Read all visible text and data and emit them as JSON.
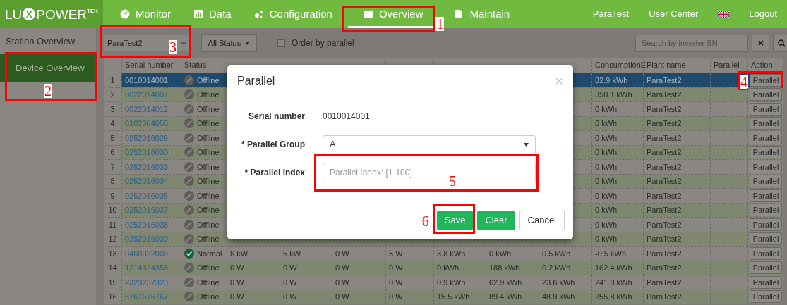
{
  "nav": {
    "logo": {
      "left": "LU",
      "mark": "X",
      "right": "POWER",
      "suffix": "TEK"
    },
    "tabs": [
      {
        "label": "Monitor",
        "selected": false
      },
      {
        "label": "Data",
        "selected": false
      },
      {
        "label": "Configuration",
        "selected": false
      },
      {
        "label": "Overview",
        "selected": true,
        "annotation": "1"
      },
      {
        "label": "Maintain",
        "selected": false
      }
    ],
    "right": [
      "ParaTest",
      "User Center"
    ],
    "logout": "Logout"
  },
  "sidebar": {
    "items": [
      {
        "label": "Station Overview",
        "selected": false
      },
      {
        "label": "Device Overview",
        "selected": true,
        "annotation": "2"
      }
    ]
  },
  "toolbar": {
    "plant_select": {
      "value": "ParaTest2",
      "annotation": "3"
    },
    "status_select": {
      "value": "All Status"
    },
    "order_checkbox": {
      "label": "Order by parallel",
      "checked": false
    },
    "search": {
      "placeholder": "Search by inverter SN"
    }
  },
  "table": {
    "columns": [
      "Serial number",
      "Status",
      "ConsumptionE",
      "Plant name",
      "Parallel",
      "Action"
    ],
    "rows": [
      {
        "index": "1",
        "serial": "0010014001",
        "status": {
          "kind": "offline",
          "label": "Offline"
        },
        "consumption": "82.9 kWh",
        "plant": "ParaTest2",
        "action": "Parallel",
        "annotation": "4",
        "selected": true
      },
      {
        "index": "2",
        "serial": "0022014007",
        "status": {
          "kind": "offline",
          "label": "Offline"
        },
        "consumption": "350.1 kWh",
        "plant": "ParaTest2",
        "action": "Parallel",
        "selected": false
      },
      {
        "index": "3",
        "serial": "0022014012",
        "status": {
          "kind": "offline",
          "label": "Offline"
        },
        "consumption": "0 kWh",
        "plant": "ParaTest2",
        "action": "Parallel",
        "selected": false
      },
      {
        "index": "4",
        "serial": "0102004050",
        "status": {
          "kind": "offline",
          "label": "Offline"
        },
        "consumption": "0 kWh",
        "plant": "ParaTest2",
        "action": "Parallel",
        "selected": false
      },
      {
        "index": "5",
        "serial": "0252016029",
        "status": {
          "kind": "offline",
          "label": "Offline"
        },
        "consumption": "0 kWh",
        "plant": "ParaTest2",
        "action": "Parallel",
        "selected": false
      },
      {
        "index": "6",
        "serial": "0252016030",
        "status": {
          "kind": "offline",
          "label": "Offline"
        },
        "consumption": "0 kWh",
        "plant": "ParaTest2",
        "action": "Parallel",
        "selected": false
      },
      {
        "index": "7",
        "serial": "0252016033",
        "status": {
          "kind": "offline",
          "label": "Offline"
        },
        "consumption": "0 kWh",
        "plant": "ParaTest2",
        "action": "Parallel",
        "selected": false
      },
      {
        "index": "8",
        "serial": "0252016034",
        "status": {
          "kind": "offline",
          "label": "Offline"
        },
        "consumption": "0 kWh",
        "plant": "ParaTest2",
        "action": "Parallel",
        "selected": false
      },
      {
        "index": "9",
        "serial": "0252016035",
        "status": {
          "kind": "offline",
          "label": "Offline"
        },
        "consumption": "0 kWh",
        "plant": "ParaTest2",
        "action": "Parallel",
        "selected": false
      },
      {
        "index": "10",
        "serial": "0252016037",
        "status": {
          "kind": "offline",
          "label": "Offline"
        },
        "consumption": "0 kWh",
        "plant": "ParaTest2",
        "action": "Parallel",
        "selected": false
      },
      {
        "index": "11",
        "serial": "0252016038",
        "status": {
          "kind": "offline",
          "label": "Offline"
        },
        "consumption": "0 kWh",
        "plant": "ParaTest2",
        "action": "Parallel",
        "selected": false
      },
      {
        "index": "12",
        "serial": "0252016039",
        "status": {
          "kind": "offline",
          "label": "Offline"
        },
        "consumption": "0 kWh",
        "plant": "ParaTest2",
        "action": "Parallel",
        "selected": false
      },
      {
        "index": "13",
        "serial": "0460022009",
        "status": {
          "kind": "normal",
          "label": "Normal"
        },
        "values": [
          "6 kW",
          "5 kW",
          "0 W",
          "5 W",
          "3.8 kWh",
          "0 kWh",
          "0.5 kWh"
        ],
        "consumption": "-0.5 kWh",
        "plant": "ParaTest2",
        "action": "Parallel",
        "selected": false
      },
      {
        "index": "14",
        "serial": "1214324353",
        "status": {
          "kind": "offline",
          "label": "Offline"
        },
        "values": [
          "0 W",
          "0 W",
          "0 W",
          "0 W",
          "0 kWh",
          "188 kWh",
          "0.2 kWh"
        ],
        "consumption": "162.4 kWh",
        "plant": "ParaTest2",
        "action": "Parallel",
        "selected": false
      },
      {
        "index": "15",
        "serial": "2323232323",
        "status": {
          "kind": "offline",
          "label": "Offline"
        },
        "values": [
          "0 W",
          "0 W",
          "0 W",
          "0 W",
          "0.9 kWh",
          "62.9 kWh",
          "23.6 kWh"
        ],
        "consumption": "241.8 kWh",
        "plant": "ParaTest2",
        "action": "Parallel",
        "selected": false
      },
      {
        "index": "16",
        "serial": "6767676767",
        "status": {
          "kind": "offline",
          "label": "Offline"
        },
        "values": [
          "0 W",
          "0 W",
          "0 W",
          "0 W",
          "15.5 kWh",
          "89.4 kWh",
          "48.9 kWh"
        ],
        "consumption": "255.8 kWh",
        "plant": "ParaTest2",
        "action": "Parallel",
        "selected": false
      }
    ]
  },
  "modal": {
    "title": "Parallel",
    "close": "×",
    "serial": {
      "label": "Serial number",
      "value": "0010014001"
    },
    "group": {
      "label": "* Parallel Group",
      "value": "A"
    },
    "index": {
      "label": "* Parallel Index",
      "placeholder": "Parallel Index: [1-100]",
      "annotation": "5"
    },
    "buttons": [
      {
        "label": "Save",
        "kind": "primary",
        "annotation": "6"
      },
      {
        "label": "Clear",
        "kind": "primary"
      },
      {
        "label": "Cancel",
        "kind": "default"
      }
    ]
  }
}
